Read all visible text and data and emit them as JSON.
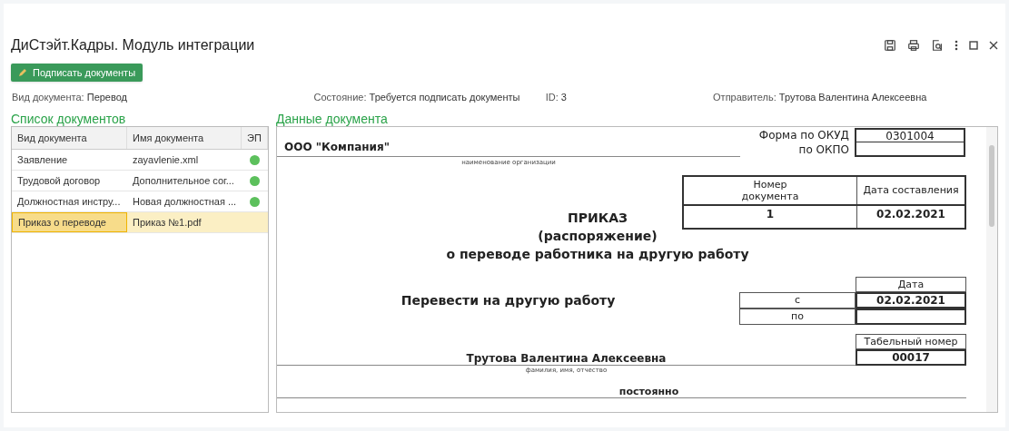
{
  "window": {
    "title": "ДиСтэйт.Кадры. Модуль интеграции"
  },
  "toolbar": {
    "sign_button": "Подписать документы"
  },
  "info": [
    {
      "label": "Вид документа:",
      "value": "Перевод"
    },
    {
      "label": "Состояние:",
      "value": "Требуется подписать документы"
    },
    {
      "label": "ID:",
      "value": "3"
    },
    {
      "label": "Отправитель:",
      "value": "Трутова Валентина Алексеевна"
    }
  ],
  "documents_list": {
    "title": "Список документов",
    "columns": [
      "Вид документа",
      "Имя документа",
      "ЭП"
    ],
    "rows": [
      {
        "type": "Заявление",
        "name": "zayavlenie.xml",
        "signed": true,
        "selected": false
      },
      {
        "type": "Трудовой договор",
        "name": "Дополнительное сог...",
        "signed": true,
        "selected": false
      },
      {
        "type": "Должностная инстру...",
        "name": "Новая должностная ...",
        "signed": true,
        "selected": false
      },
      {
        "type": "Приказ о переводе",
        "name": "Приказ №1.pdf",
        "signed": false,
        "selected": true
      }
    ]
  },
  "document_data": {
    "title": "Данные документа",
    "organization": "ООО \"Компания\"",
    "organization_caption": "наименование организации",
    "okud_label": "Форма по ОКУД",
    "okud_value": "0301004",
    "okpo_label": "по ОКПО",
    "number_header": "Номер документа",
    "date_header": "Дата составления",
    "number": "1",
    "date": "02.02.2021",
    "heading": [
      "ПРИКАЗ",
      "(распоряжение)",
      "о переводе работника на другую работу"
    ],
    "action": "Перевести на другую работу",
    "period_header": "Дата",
    "from_label": "с",
    "from_date": "02.02.2021",
    "to_label": "по",
    "tab_header": "Табельный номер",
    "tab_number": "00017",
    "employee": "Трутова Валентина Алексеевна",
    "employee_caption": "фамилия, имя, отчество",
    "transfer_kind": "постоянно"
  }
}
